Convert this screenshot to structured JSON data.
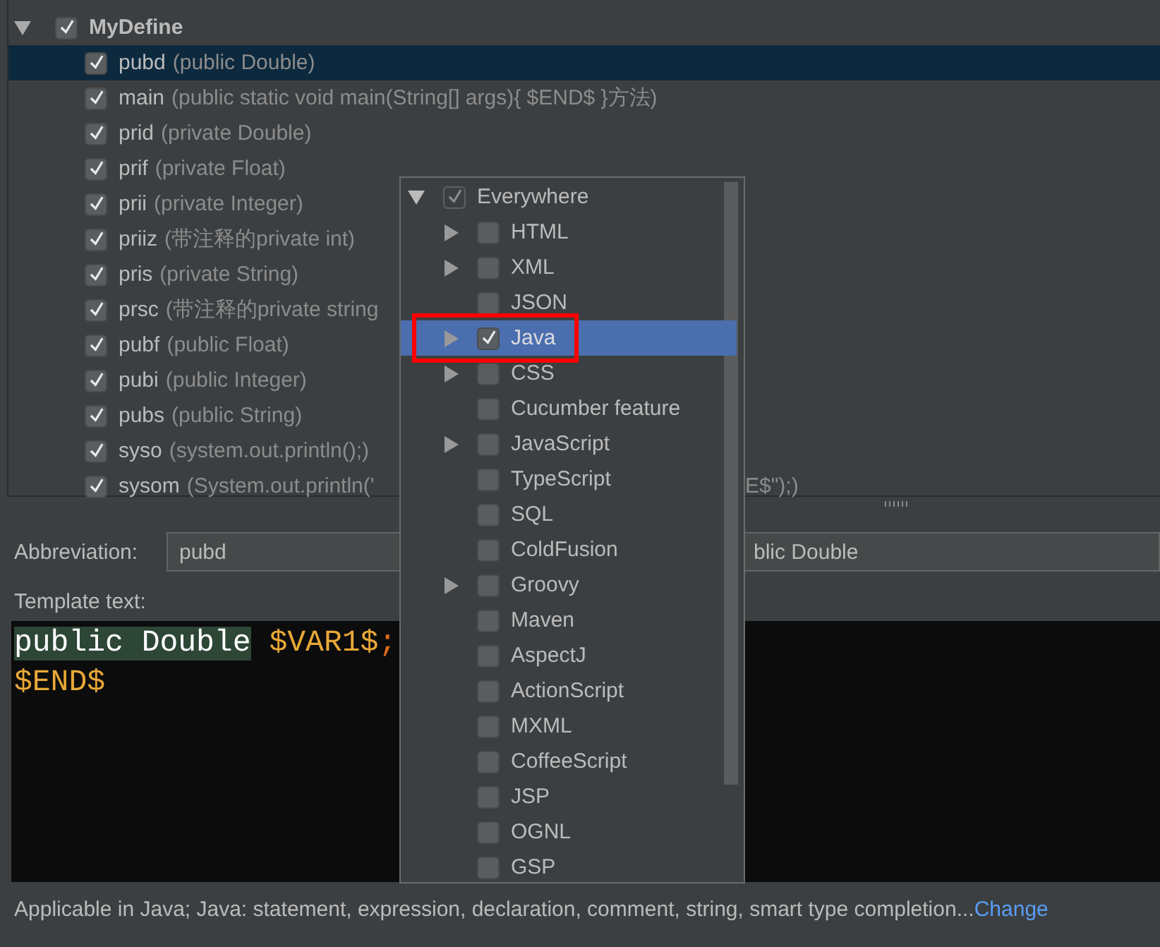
{
  "template_tree": {
    "groups": [
      {
        "name": "MyDefine",
        "expanded": true,
        "checked": true,
        "children": [
          {
            "abbreviation": "pubd",
            "description": "(public Double)",
            "checked": true,
            "selected": true
          },
          {
            "abbreviation": "main",
            "description": "(public static void main(String[] args){   $END$ }方法)",
            "checked": true,
            "selected": false
          },
          {
            "abbreviation": "prid",
            "description": "(private Double)",
            "checked": true,
            "selected": false
          },
          {
            "abbreviation": "prif",
            "description": "(private Float)",
            "checked": true,
            "selected": false
          },
          {
            "abbreviation": "prii",
            "description": "(private Integer)",
            "checked": true,
            "selected": false
          },
          {
            "abbreviation": "priiz",
            "description": "(带注释的private int)",
            "checked": true,
            "selected": false
          },
          {
            "abbreviation": "pris",
            "description": "(private String)",
            "checked": true,
            "selected": false
          },
          {
            "abbreviation": "prsc",
            "description": "(带注释的private string",
            "checked": true,
            "selected": false
          },
          {
            "abbreviation": "pubf",
            "description": "(public Float)",
            "checked": true,
            "selected": false
          },
          {
            "abbreviation": "pubi",
            "description": "(public Integer)",
            "checked": true,
            "selected": false
          },
          {
            "abbreviation": "pubs",
            "description": "(public String)",
            "checked": true,
            "selected": false
          },
          {
            "abbreviation": "syso",
            "description": "(system.out.println();)",
            "checked": true,
            "selected": false
          },
          {
            "abbreviation": "sysom",
            "description": "(System.out.println('",
            "description_after_popup": "E$\");)",
            "checked": true,
            "selected": false
          }
        ]
      }
    ]
  },
  "abbreviation": {
    "label": "Abbreviation:",
    "value": "pubd"
  },
  "description_field": {
    "value": "blic Double"
  },
  "template_text": {
    "label": "Template text:",
    "lines": [
      [
        {
          "text": "public Double",
          "kind": "selection"
        },
        {
          "text": "$VAR1$",
          "kind": "variable"
        },
        {
          "text": ";",
          "kind": "punctuation"
        }
      ],
      [
        {
          "text": "$END$",
          "kind": "variable"
        }
      ]
    ]
  },
  "applicable": {
    "text": "Applicable in Java; Java: statement, expression, declaration, comment, string, smart type completion...",
    "link": "Change"
  },
  "context_popup": {
    "items": [
      {
        "label": "Everywhere",
        "checked": true,
        "disabled": true,
        "expanded": true,
        "children": [
          {
            "label": "HTML",
            "checked": false,
            "expandable": true,
            "selected": false
          },
          {
            "label": "XML",
            "checked": false,
            "expandable": true,
            "selected": false
          },
          {
            "label": "JSON",
            "checked": false,
            "expandable": false,
            "selected": false
          },
          {
            "label": "Java",
            "checked": true,
            "expandable": true,
            "selected": true
          },
          {
            "label": "CSS",
            "checked": false,
            "expandable": true,
            "selected": false
          },
          {
            "label": "Cucumber feature",
            "checked": false,
            "expandable": false,
            "selected": false
          },
          {
            "label": "JavaScript",
            "checked": false,
            "expandable": true,
            "selected": false
          },
          {
            "label": "TypeScript",
            "checked": false,
            "expandable": false,
            "selected": false
          },
          {
            "label": "SQL",
            "checked": false,
            "expandable": false,
            "selected": false
          },
          {
            "label": "ColdFusion",
            "checked": false,
            "expandable": false,
            "selected": false
          },
          {
            "label": "Groovy",
            "checked": false,
            "expandable": true,
            "selected": false
          },
          {
            "label": "Maven",
            "checked": false,
            "expandable": false,
            "selected": false
          },
          {
            "label": "AspectJ",
            "checked": false,
            "expandable": false,
            "selected": false
          },
          {
            "label": "ActionScript",
            "checked": false,
            "expandable": false,
            "selected": false
          },
          {
            "label": "MXML",
            "checked": false,
            "expandable": false,
            "selected": false
          },
          {
            "label": "CoffeeScript",
            "checked": false,
            "expandable": false,
            "selected": false
          },
          {
            "label": "JSP",
            "checked": false,
            "expandable": false,
            "selected": false
          },
          {
            "label": "OGNL",
            "checked": false,
            "expandable": false,
            "selected": false
          },
          {
            "label": "GSP",
            "checked": false,
            "expandable": false,
            "selected": false
          }
        ]
      }
    ]
  }
}
